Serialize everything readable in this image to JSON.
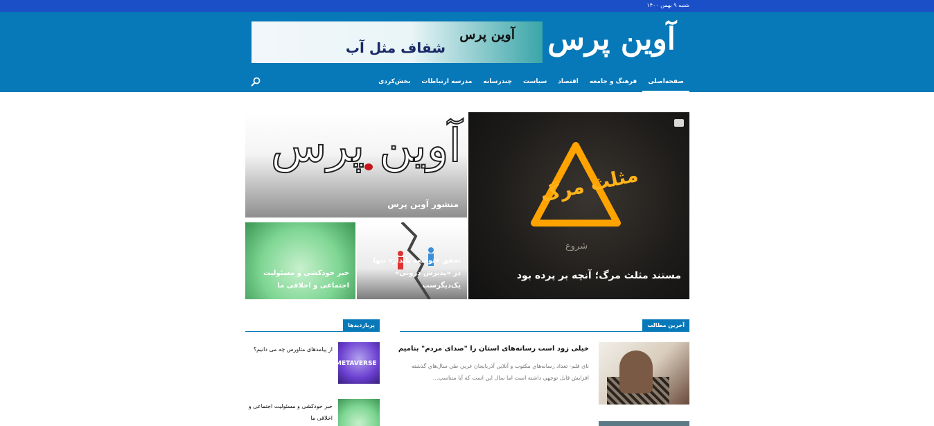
{
  "topbar": {
    "date": "شنبه ۹ بهمن ۱۴۰۰"
  },
  "header": {
    "logo": "آوین پرس",
    "banner": {
      "brand": "آوین پرس",
      "tagline": "شفاف مثل آب"
    }
  },
  "nav": {
    "items": [
      {
        "label": "صفحه‌اصلی",
        "active": true
      },
      {
        "label": "فرهنگ و جامعه"
      },
      {
        "label": "اقتصاد"
      },
      {
        "label": "سیاست"
      },
      {
        "label": "چندرسانه"
      },
      {
        "label": "مدرسه ارتباطات"
      },
      {
        "label": "بخش‌کردی"
      }
    ],
    "search_icon": "search-icon"
  },
  "hero": {
    "main": {
      "title": "مستند مثلث مرگ؛ آنچه بر پرده بود",
      "art_text": "مثلث مرگ",
      "art_sub": "شروع"
    },
    "top": {
      "title": "منشور آوین پرس",
      "art_text": "آوین پرس"
    },
    "small1": {
      "title": "تحقق «توسعه پایدار» تنها در «پذیرش درونی» یک‌دیگرست"
    },
    "small2": {
      "title": "خبر خودکشی و مسئولیت اجتماعی و اخلاقی ما"
    }
  },
  "sections": {
    "latest": "آخرین مطالب",
    "popular": "پربازدیدها"
  },
  "latest_posts": [
    {
      "title": "خیلی زود است رسانه‌های استان را \"صدای مردم\" بنامیم",
      "excerpt": "نای قلم- تعداد رسانه‌هاي مكتوب و آنلاين آذربايجان غربي طي سال‌هاي گذشته افزايش قابل توجهي داشته است اما سال اين است كه آيا متناسب..."
    }
  ],
  "popular_posts": [
    {
      "title": "از پیامدهای متاورس چه می دانیم؟",
      "thumb_text": "METAVERSE"
    },
    {
      "title": "خبر خودکشی و مسئولیت اجتماعی و اخلاقی ما"
    }
  ]
}
